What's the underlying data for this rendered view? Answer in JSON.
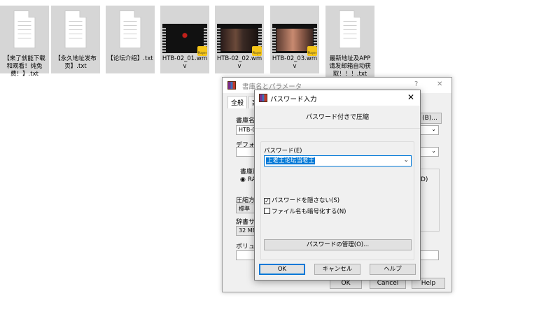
{
  "desktop": {
    "files": [
      {
        "label": "【来了就能下载和观看！纯免费！】.txt",
        "kind": "txt"
      },
      {
        "label": "【永久地址发布页】.txt",
        "kind": "txt"
      },
      {
        "label": "【论坛介绍】.txt",
        "kind": "txt"
      },
      {
        "label": "HTB-02_01.wmv",
        "kind": "video",
        "badge": "Player"
      },
      {
        "label": "HTB-02_02.wmv",
        "kind": "video",
        "badge": "Player"
      },
      {
        "label": "HTB-02_03.wmv",
        "kind": "video",
        "badge": "Player"
      },
      {
        "label": "最新地址及APP请发邮箱自动获取！！！.txt",
        "kind": "txt"
      }
    ]
  },
  "archive_dialog": {
    "title": "書庫名とパラメータ",
    "help_glyph": "?",
    "close_glyph": "✕",
    "tabs": [
      "全般",
      "高"
    ],
    "archive_name_label": "書庫名",
    "archive_name_value": "HTB-0",
    "browse_button": "(B)...",
    "default_label": "デフォル",
    "format_label": "書庫形",
    "format_option": "RA",
    "compression_label": "圧縮方",
    "compression_value": "標準",
    "dictionary_label": "辞書サ",
    "dictionary_value": "32 MB",
    "volume_label": "ボリュー",
    "side_option": "D)",
    "ok": "OK",
    "cancel": "Cancel",
    "help": "Help"
  },
  "password_dialog": {
    "title": "パスワード入力",
    "close_glyph": "✕",
    "subtitle": "パスワード付きで圧縮",
    "password_label": "パスワード(E)",
    "password_value": "上老王论坛当老王",
    "show_password_label": "パスワードを隠さない(S)",
    "show_password_checked": true,
    "encrypt_names_label": "ファイル名も暗号化する(N)",
    "encrypt_names_checked": false,
    "manage_button": "パスワードの管理(O)...",
    "ok": "OK",
    "cancel": "キャンセル",
    "help": "ヘルプ"
  }
}
